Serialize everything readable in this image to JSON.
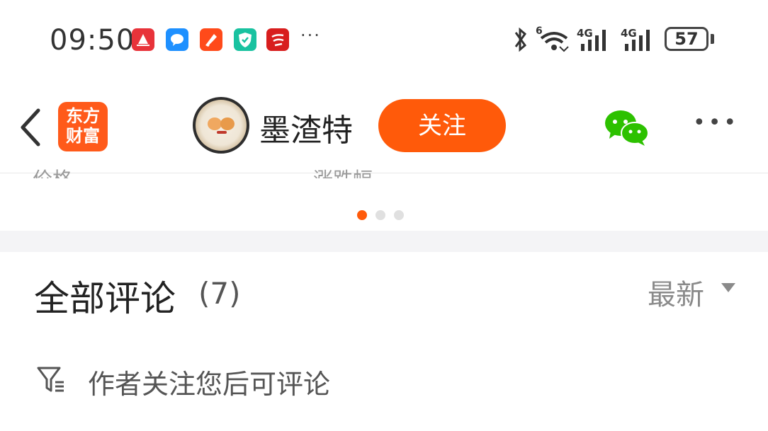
{
  "status_bar": {
    "time": "09:50",
    "app_icons": [
      {
        "name": "news-app-icon",
        "color": "#e8333a"
      },
      {
        "name": "message-app-icon",
        "color": "#1e90ff"
      },
      {
        "name": "finance-app-icon",
        "color": "#ff4a1a"
      },
      {
        "name": "security-app-icon",
        "color": "#19c2a0"
      },
      {
        "name": "study-app-icon",
        "color": "#d81e1e"
      }
    ],
    "more": "···",
    "network_1": "4G",
    "network_2": "4G",
    "wifi_label": "6",
    "battery": "57"
  },
  "nav": {
    "logo_line1": "东方",
    "logo_line2": "财富",
    "username": "墨渣特",
    "follow_label": "关注",
    "more": "•••"
  },
  "partial": {
    "left": "价格",
    "right": "涨跌幅"
  },
  "pager": {
    "active_index": 0,
    "count": 3
  },
  "comments": {
    "title": "全部评论",
    "count": "(7)",
    "sort_label": "最新",
    "hint": "作者关注您后可评论"
  },
  "colors": {
    "accent": "#ff5a0a",
    "wechat": "#2dc100"
  }
}
